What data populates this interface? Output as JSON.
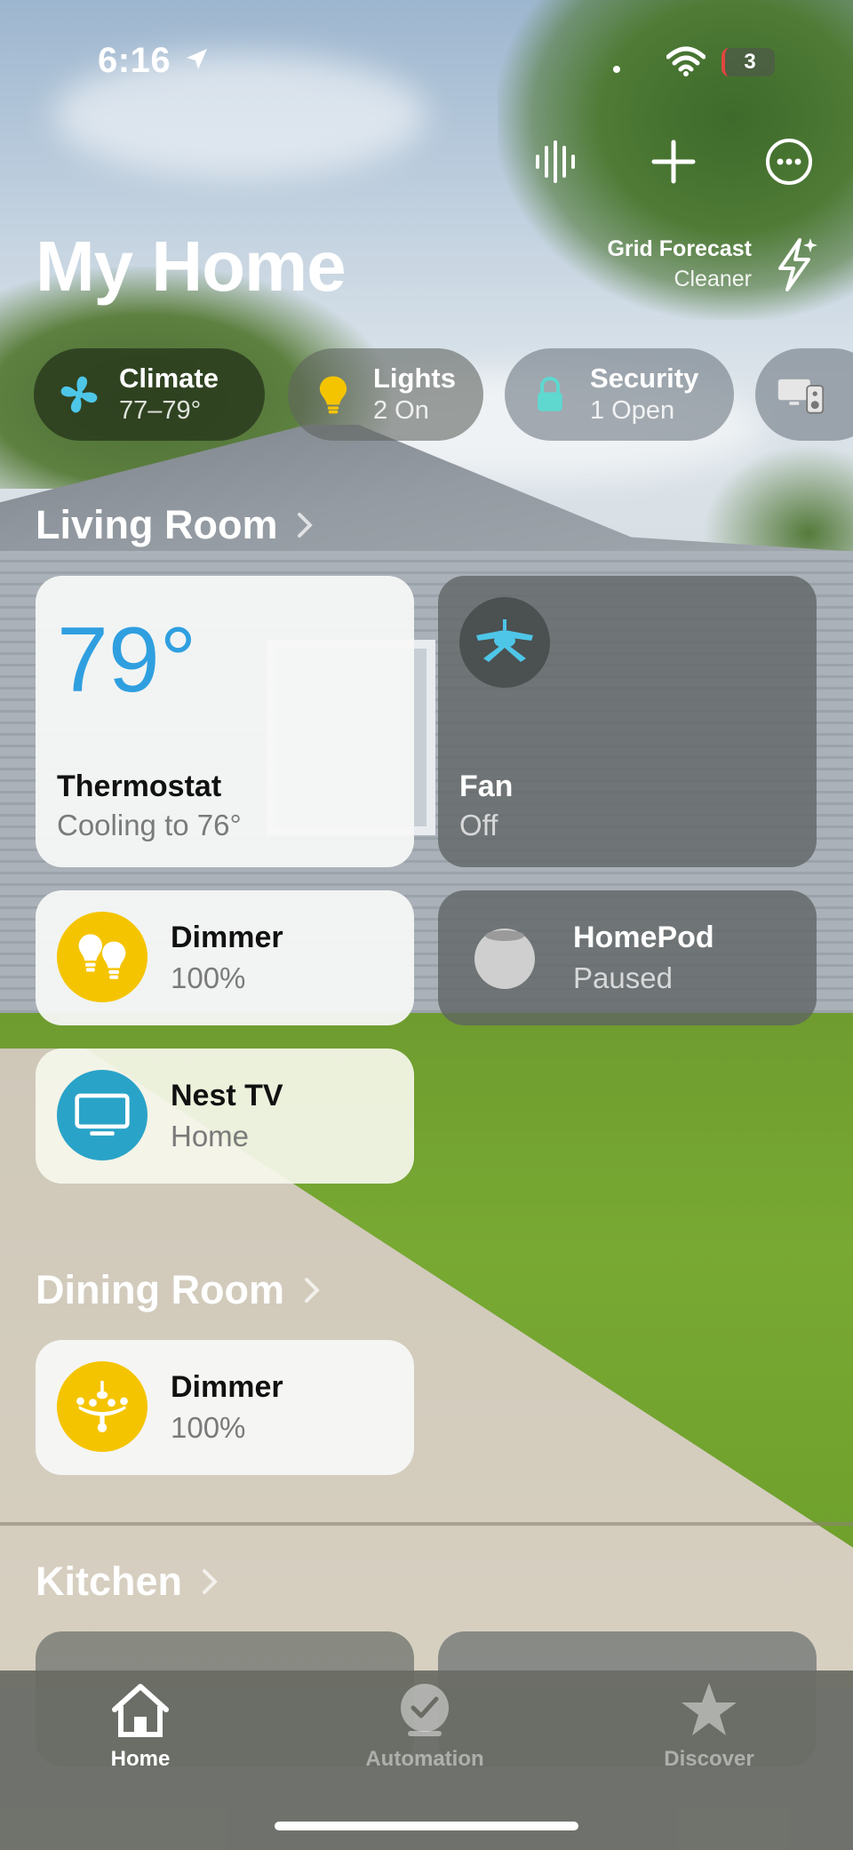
{
  "status_bar": {
    "time": "6:16",
    "battery_label": "3"
  },
  "header": {
    "title": "My Home",
    "grid_forecast": {
      "title": "Grid Forecast",
      "subtitle": "Cleaner"
    }
  },
  "categories": [
    {
      "label": "Climate",
      "detail": "77–79°",
      "icon": "fan-icon"
    },
    {
      "label": "Lights",
      "detail": "2 On",
      "icon": "lightbulb-icon"
    },
    {
      "label": "Security",
      "detail": "1 Open",
      "icon": "lock-icon"
    },
    {
      "label": "",
      "detail": "",
      "icon": "speakers-tv-icon"
    }
  ],
  "rooms": {
    "living_room": {
      "title": "Living Room",
      "accessories": {
        "thermostat": {
          "value": "79°",
          "name": "Thermostat",
          "state": "Cooling to 76°"
        },
        "fan": {
          "name": "Fan",
          "state": "Off"
        },
        "dimmer": {
          "name": "Dimmer",
          "state": "100%"
        },
        "homepod": {
          "name": "HomePod",
          "state": "Paused"
        },
        "nest_tv": {
          "name": "Nest TV",
          "state": "Home"
        }
      }
    },
    "dining_room": {
      "title": "Dining Room",
      "accessories": {
        "dimmer": {
          "name": "Dimmer",
          "state": "100%"
        }
      }
    },
    "kitchen": {
      "title": "Kitchen"
    }
  },
  "tabs": [
    {
      "label": "Home",
      "icon": "house-icon",
      "selected": true
    },
    {
      "label": "Automation",
      "icon": "clock-check-icon",
      "selected": false
    },
    {
      "label": "Discover",
      "icon": "star-icon",
      "selected": false
    }
  ],
  "colors": {
    "thermostat_temp": "#2f9fe0",
    "light_on_yellow": "#f5c400",
    "fan_cyan": "#4ec6e8",
    "tv_teal": "#2aa3c8",
    "lock_teal": "#5fd8d0"
  }
}
